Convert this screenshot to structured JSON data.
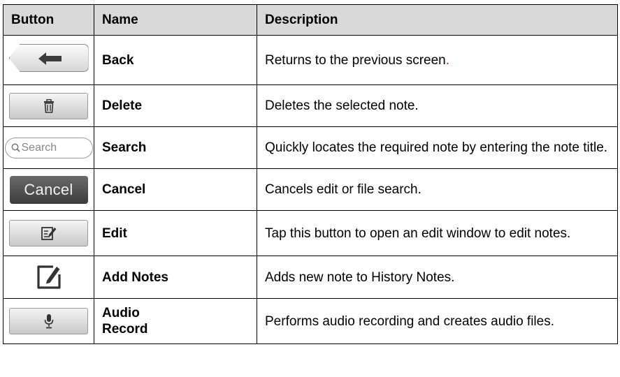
{
  "table": {
    "headers": {
      "button": "Button",
      "name": "Name",
      "description": "Description"
    },
    "rows": [
      {
        "icon": "back-arrow-icon",
        "name": "Back",
        "description": "Returns to the previous screen",
        "description_tail": "."
      },
      {
        "icon": "trash-icon",
        "name": "Delete",
        "description": "Deletes the selected note."
      },
      {
        "icon": "search-icon",
        "search_text": "Search",
        "name": "Search",
        "description": "Quickly locates the required note by entering the note title."
      },
      {
        "icon": "cancel-button",
        "cancel_text": "Cancel",
        "name": "Cancel",
        "description": "Cancels edit or file search."
      },
      {
        "icon": "edit-icon",
        "name": "Edit",
        "description": "Tap this button to open an edit window to edit notes."
      },
      {
        "icon": "add-note-icon",
        "name": "Add Notes",
        "description": "Adds new note to History Notes."
      },
      {
        "icon": "microphone-icon",
        "name": "Audio Record",
        "description": "Performs audio recording and creates audio files."
      }
    ]
  },
  "colors": {
    "header_bg": "#d9d9d9",
    "period_accent": "#e01010",
    "cancel_bg": "#4a4a4a"
  }
}
